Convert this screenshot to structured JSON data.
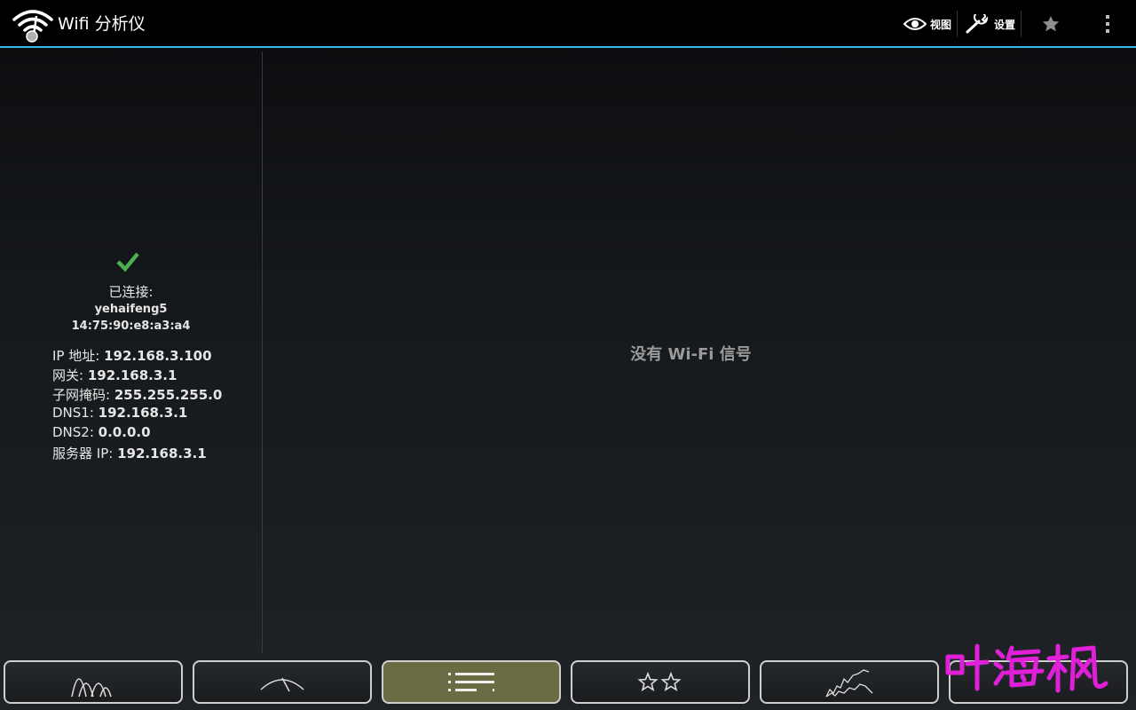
{
  "app": {
    "title": "Wifi 分析仪"
  },
  "actions": {
    "view_label": "视图",
    "settings_label": "设置"
  },
  "connection": {
    "status_label": "已连接:",
    "ssid": "yehaifeng5",
    "bssid": "14:75:90:e8:a3:a4",
    "info": [
      {
        "label": "IP 地址:",
        "value": "192.168.3.100"
      },
      {
        "label": "网关:",
        "value": "192.168.3.1"
      },
      {
        "label": "子网掩码:",
        "value": "255.255.255.0"
      },
      {
        "label": "DNS1:",
        "value": "192.168.3.1"
      },
      {
        "label": "DNS2:",
        "value": "0.0.0.0"
      },
      {
        "label": "服务器 IP:",
        "value": "192.168.3.1"
      }
    ]
  },
  "main": {
    "empty_message": "没有 Wi-Fi 信号"
  },
  "tabs": [
    {
      "icon": "channel-graph-icon",
      "active": false
    },
    {
      "icon": "signal-meter-icon",
      "active": false
    },
    {
      "icon": "ap-list-icon",
      "active": true
    },
    {
      "icon": "channel-rating-icon",
      "active": false
    },
    {
      "icon": "time-graph-icon",
      "active": false
    },
    {
      "icon": "blank",
      "active": false
    }
  ],
  "watermark": {
    "text": "叶海枫",
    "color": "#e020d8"
  },
  "colors": {
    "accent": "#33b5e5",
    "connected_check": "#4caf50",
    "active_tab": "#6a6c43"
  }
}
